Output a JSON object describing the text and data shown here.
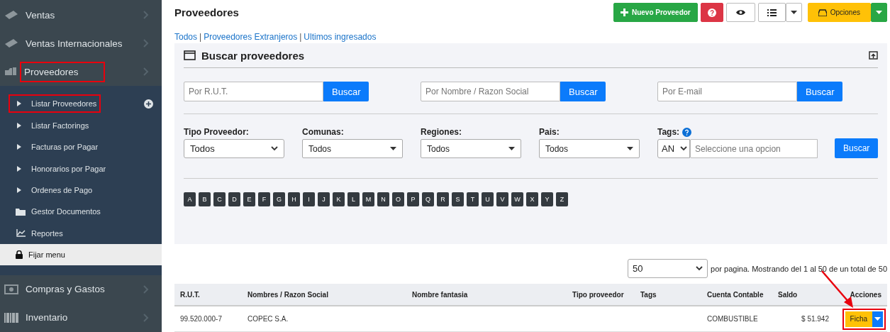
{
  "sidebar": {
    "items": [
      {
        "label": "Ventas",
        "expanded": false,
        "highlighted": false
      },
      {
        "label": "Ventas Internacionales",
        "expanded": false,
        "highlighted": false
      },
      {
        "label": "Proveedores",
        "expanded": true,
        "highlighted": true,
        "children": [
          {
            "label": "Listar Proveedores",
            "kind": "bullet",
            "highlighted": true,
            "add": true
          },
          {
            "label": "Listar Factorings",
            "kind": "bullet",
            "highlighted": false,
            "add": false
          },
          {
            "label": "Facturas por Pagar",
            "kind": "bullet",
            "highlighted": false,
            "add": false
          },
          {
            "label": "Honorarios por Pagar",
            "kind": "bullet",
            "highlighted": false,
            "add": false
          },
          {
            "label": "Ordenes de Pago",
            "kind": "bullet",
            "highlighted": false,
            "add": false
          },
          {
            "label": "Gestor Documentos",
            "kind": "folder",
            "highlighted": false,
            "add": false
          },
          {
            "label": "Reportes",
            "kind": "chart",
            "highlighted": false,
            "add": false
          }
        ]
      },
      {
        "label": "Compras y Gastos",
        "expanded": false,
        "highlighted": false
      },
      {
        "label": "Inventario",
        "expanded": false,
        "highlighted": false
      }
    ],
    "pin": {
      "label": "Fijar menu"
    }
  },
  "page": {
    "title": "Proveedores",
    "new_button": "Nuevo Proveedor",
    "options_button": "Opciones"
  },
  "links": {
    "separator": "|",
    "items": [
      "Todos",
      "Proveedores Extranjeros",
      "Ultimos ingresados"
    ]
  },
  "search_panel": {
    "title": "Buscar proveedores",
    "searches": [
      {
        "placeholder": "Por R.U.T.",
        "button": "Buscar"
      },
      {
        "placeholder": "Por Nombre / Razon Social",
        "button": "Buscar"
      },
      {
        "placeholder": "Por E-mail",
        "button": "Buscar"
      }
    ],
    "filters": [
      {
        "label": "Tipo Proveedor:",
        "value": "Todos",
        "kind": "native"
      },
      {
        "label": "Comunas:",
        "value": "Todos",
        "kind": "custom"
      },
      {
        "label": "Regiones:",
        "value": "Todos",
        "kind": "custom"
      },
      {
        "label": "Pais:",
        "value": "Todos",
        "kind": "custom"
      }
    ],
    "tags": {
      "label": "Tags:",
      "operator": "AN",
      "placeholder": "Seleccione una opcion"
    },
    "filter_button": "Buscar",
    "letters": [
      "A",
      "B",
      "C",
      "D",
      "E",
      "F",
      "G",
      "H",
      "I",
      "J",
      "K",
      "L",
      "M",
      "N",
      "O",
      "P",
      "Q",
      "R",
      "S",
      "T",
      "U",
      "V",
      "W",
      "X",
      "Y",
      "Z"
    ]
  },
  "pagination": {
    "per_page": "50",
    "summary": "por pagina. Mostrando del 1 al 50 de un total de 50"
  },
  "table": {
    "columns": [
      "R.U.T.",
      "Nombres / Razon Social",
      "Nombre fantasia",
      "Tipo proveedor",
      "Tags",
      "Cuenta Contable",
      "Saldo",
      "Acciones"
    ],
    "rows": [
      {
        "cells": [
          "99.520.000-7",
          "COPEC S.A.",
          "",
          "",
          "",
          "COMBUSTIBLE",
          "$ 51.942"
        ],
        "action": "Ficha",
        "highlighted": true
      }
    ]
  }
}
